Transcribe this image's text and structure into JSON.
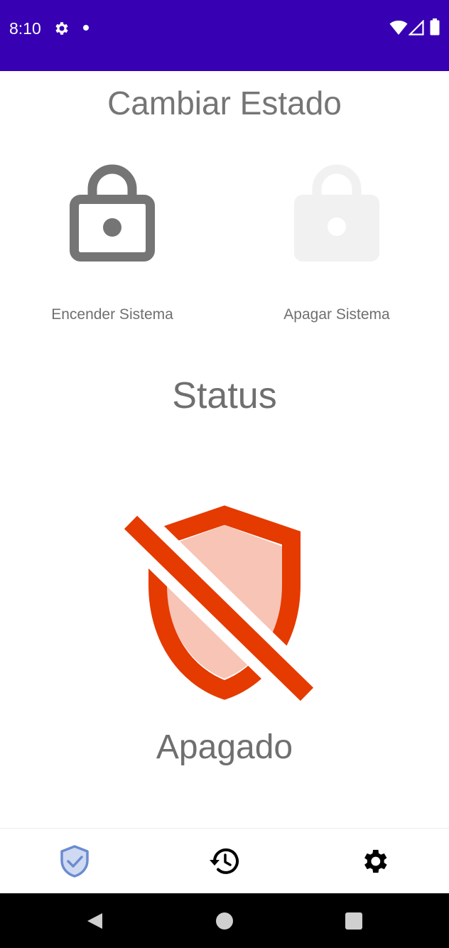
{
  "status_bar": {
    "time": "8:10",
    "icons": [
      "gear-icon",
      "notification-dot-icon",
      "wifi-icon",
      "signal-icon",
      "battery-icon"
    ],
    "background": "#3700b3"
  },
  "main": {
    "title": "Cambiar Estado",
    "actions": [
      {
        "label": "Encender Sistema",
        "icon": "unlock-icon",
        "enabled": true,
        "color": "#757575"
      },
      {
        "label": "Apagar Sistema",
        "icon": "lock-icon",
        "enabled": false,
        "color": "#f1f1f1"
      }
    ],
    "status_heading": "Status",
    "status_icon": "shield-off-icon",
    "status_color": "#e53a00",
    "status_value": "Apagado"
  },
  "bottom_nav": {
    "items": [
      {
        "icon": "shield-check-icon",
        "selected": true,
        "color": "#6a8cd0"
      },
      {
        "icon": "history-icon",
        "selected": false,
        "color": "#000000"
      },
      {
        "icon": "settings-icon",
        "selected": false,
        "color": "#000000"
      }
    ]
  },
  "system_nav": {
    "buttons": [
      "back-icon",
      "home-icon",
      "recents-icon"
    ]
  }
}
